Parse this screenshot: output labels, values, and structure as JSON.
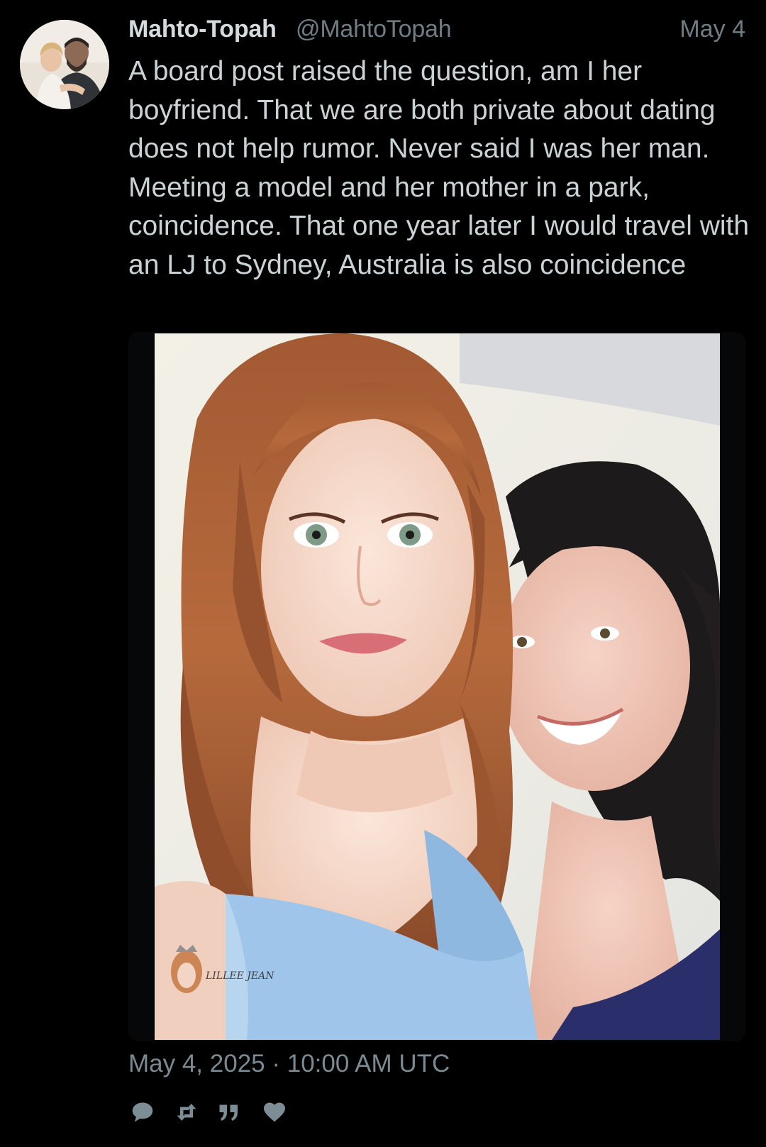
{
  "author": {
    "display_name": "Mahto-Topah",
    "handle": "@MahtoTopah",
    "date_short": "May 4",
    "avatar_icon": "profile-photo"
  },
  "post": {
    "text": "A board post raised the question, am I her boyfriend. That we are both private about dating does not help rumor. Never said I was her man. Meeting a model and her mother in a park, coincidence. That one year later I would travel with an LJ to Sydney, Australia is also coincidence",
    "timestamp": "May 4, 2025 · 10:00 AM UTC"
  },
  "media": {
    "type": "photo",
    "watermark_logo": "LILLEE JEAN"
  },
  "actions": [
    {
      "name": "reply",
      "icon": "speech-bubble-icon"
    },
    {
      "name": "retweet",
      "icon": "retweet-icon"
    },
    {
      "name": "quote",
      "icon": "quote-icon"
    },
    {
      "name": "like",
      "icon": "heart-icon"
    }
  ],
  "colors": {
    "background": "#000000",
    "text": "#c9d3d6",
    "muted": "#6f7d84",
    "icon": "#7d8d95"
  }
}
